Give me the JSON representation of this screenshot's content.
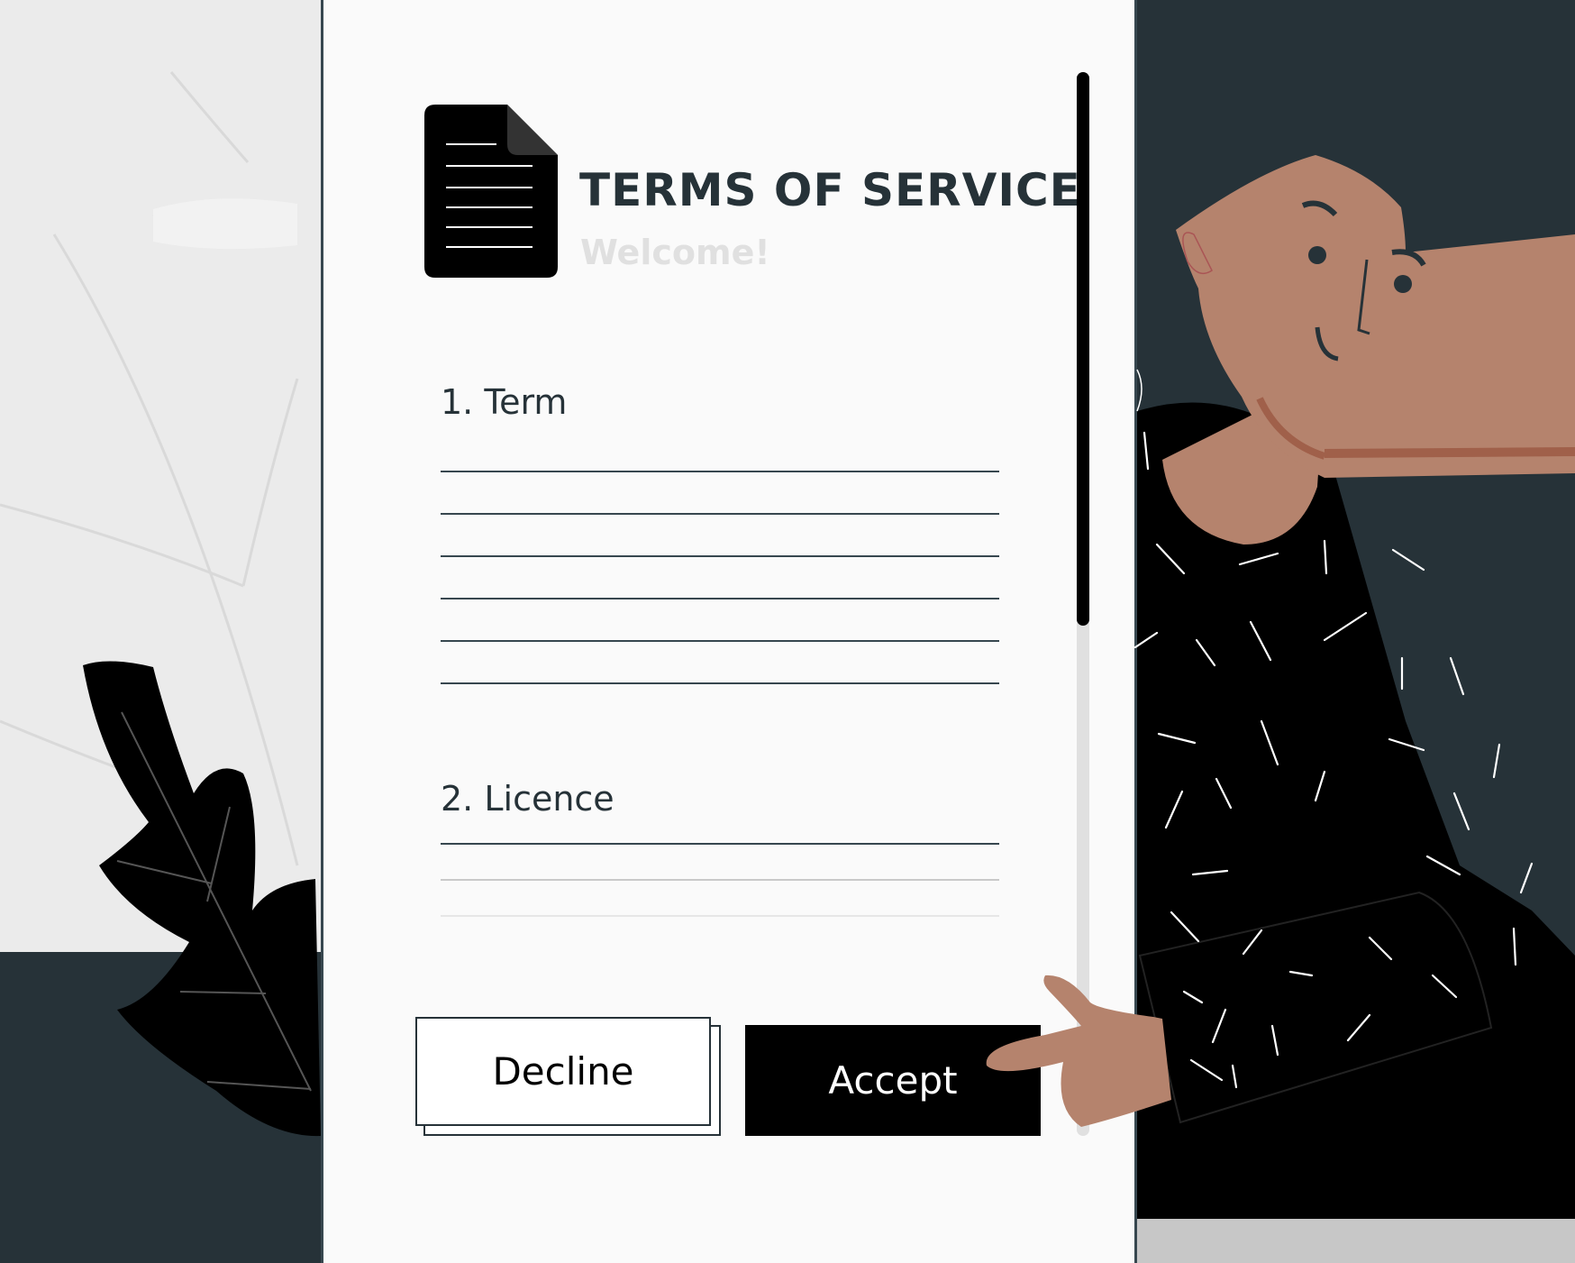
{
  "dialog": {
    "title": "TERMS OF SERVICE",
    "subtitle": "Welcome!",
    "sections": [
      {
        "heading": "1. Term"
      },
      {
        "heading": "2. Licence"
      }
    ],
    "buttons": {
      "decline_label": "Decline",
      "accept_label": "Accept"
    },
    "scrollbar": {
      "scroll_position_fraction": 0.0,
      "visible_fraction": 0.52
    }
  },
  "icons": {
    "document": "document-icon"
  },
  "colors": {
    "background": "#263238",
    "card": "#fafafa",
    "text": "#263238",
    "accept_button": "#000000",
    "skin": "#b5836d"
  }
}
